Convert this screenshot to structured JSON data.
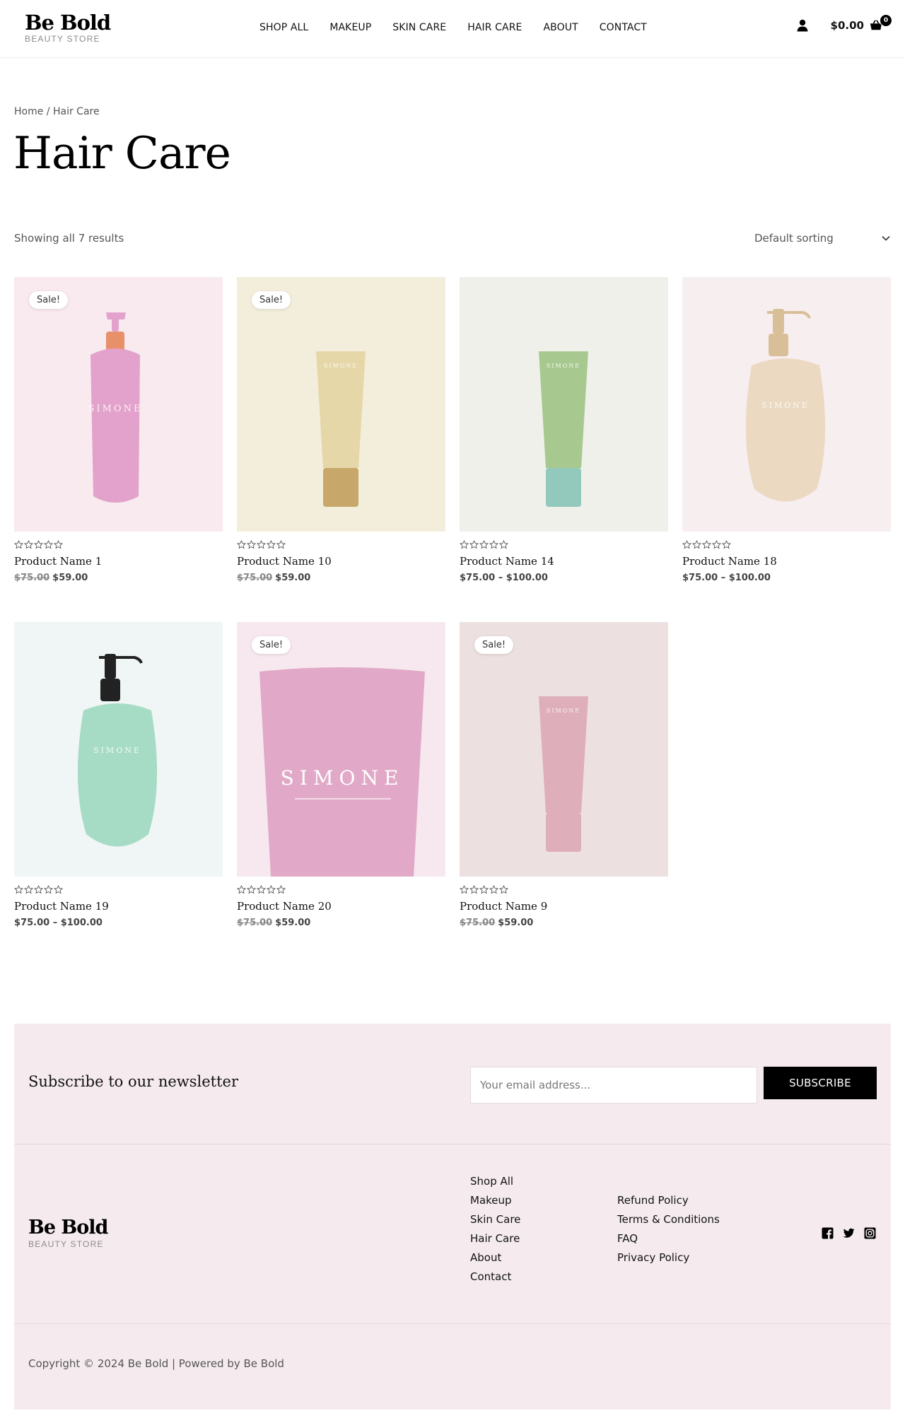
{
  "header": {
    "logo_title": "Be Bold",
    "logo_sub": "BEAUTY STORE",
    "nav": [
      "SHOP ALL",
      "MAKEUP",
      "SKIN CARE",
      "HAIR CARE",
      "ABOUT",
      "CONTACT"
    ],
    "cart_amount": "$0.00",
    "cart_count": "0",
    "user_icon": "user-icon",
    "cart_icon": "shopping-basket-icon"
  },
  "breadcrumb": {
    "home": "Home",
    "separator": " / ",
    "current": "Hair Care"
  },
  "page_title": "Hair Care",
  "results_text": "Showing all 7 results",
  "sorting": {
    "selected": "Default sorting",
    "icon": "chevron-down-icon"
  },
  "products": [
    {
      "name": "Product Name 1",
      "sale": "Sale!",
      "old_price": "$75.00",
      "price": "$59.00",
      "bg": "#f8eaee",
      "kind": "pump-bottle",
      "color": "#e3a2cb",
      "accent": "#e8906a",
      "brand": "SIMONE"
    },
    {
      "name": "Product Name 10",
      "sale": "Sale!",
      "old_price": "$75.00",
      "price": "$59.00",
      "bg": "#f3eedc",
      "kind": "tube-cap-bottom",
      "color": "#e6d7a8",
      "accent": "#c8a86a",
      "brand": "SIMONE"
    },
    {
      "name": "Product Name 14",
      "sale": "",
      "old_price": "",
      "price": "$75.00 – $100.00",
      "bg": "#eff0ea",
      "kind": "tube-cap-bottom",
      "color": "#a7c98f",
      "accent": "#93c9bc",
      "brand": "SIMONE"
    },
    {
      "name": "Product Name 18",
      "sale": "",
      "old_price": "",
      "price": "$75.00 – $100.00",
      "bg": "#f7eef0",
      "kind": "pump-round",
      "color": "#ebd9c2",
      "accent": "#d8bf98",
      "brand": "SIMONE"
    },
    {
      "name": "Product Name 19",
      "sale": "",
      "old_price": "",
      "price": "$75.00 – $100.00",
      "bg": "#eff6f5",
      "kind": "pump-round",
      "color": "#a6dcc5",
      "accent": "#222222",
      "brand": "SIMONE"
    },
    {
      "name": "Product Name 20",
      "sale": "Sale!",
      "old_price": "$75.00",
      "price": "$59.00",
      "bg": "#f6e8ee",
      "kind": "tube-closeup",
      "color": "#e1a9c7",
      "accent": "#ffffff",
      "brand": "SIMONE"
    },
    {
      "name": "Product Name 9",
      "sale": "Sale!",
      "old_price": "$75.00",
      "price": "$59.00",
      "bg": "#ede0e1",
      "kind": "tube-cap-bottom",
      "color": "#dfaebb",
      "accent": "#dfaebb",
      "brand": "SIMONE"
    }
  ],
  "rating": 0,
  "footer": {
    "newsletter_text": "Subscribe to our newsletter",
    "email_placeholder": "Your email address...",
    "subscribe_label": "SUBSCRIBE",
    "links_col1": [
      "Shop All",
      "Makeup",
      "Skin Care",
      "Hair Care",
      "About",
      "Contact"
    ],
    "links_col2": [
      "Refund Policy",
      "Terms & Conditions",
      "FAQ",
      "Privacy Policy"
    ],
    "social": [
      "facebook-icon",
      "twitter-icon",
      "instagram-icon"
    ],
    "copyright": "Copyright © 2024 Be Bold | Powered by Be Bold"
  }
}
